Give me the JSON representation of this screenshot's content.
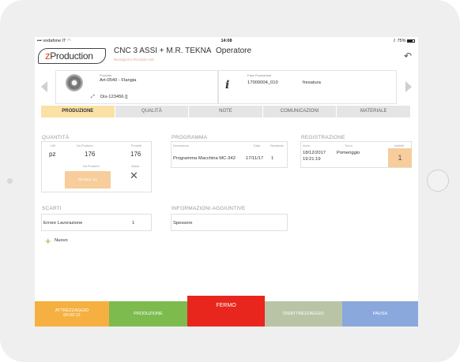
{
  "status_bar": {
    "carrier": "vodafone IT",
    "time": "14:08",
    "battery": "75%"
  },
  "header": {
    "brand_prefix": "z",
    "brand_rest": "Production",
    "title": "CNC 3 ASSI + M.R. TEKNA",
    "role": "Operatore",
    "subtitle": "Buongiorno Riccardo Aldi"
  },
  "product": {
    "label": "Prodotto",
    "name": "Art-0540 - Flangia",
    "drawing": "Dis-123456 []"
  },
  "phase": {
    "label": "Fase Produzione",
    "code": "17000004_010",
    "name": "fresatura"
  },
  "tabs": [
    "PRODUZIONE",
    "QUALITÀ",
    "NOTE",
    "COMUNICAZIONI",
    "MATERIALE"
  ],
  "quantity": {
    "title": "QUANTITÀ",
    "um_label": "UM",
    "um": "pz",
    "toproduce_label": "Da Produrre",
    "toproduce": "176",
    "produced_label": "Prodotti",
    "produced": "176",
    "declare_label": "Da Produrre",
    "declare_button": "Dichiara 1/1",
    "close_label": "Salda"
  },
  "program": {
    "title": "PROGRAMMA",
    "desc_label": "Descrizione",
    "date_label": "Data",
    "rev_label": "Revisione",
    "desc": "Programma Macchina MC-342",
    "date": "17/11/17",
    "rev": "1"
  },
  "registration": {
    "title": "REGISTRAZIONE",
    "start_label": "Inizio",
    "shift_label": "Turno",
    "workers_label": "Addetti",
    "start_date": "18/12/2017",
    "start_time": "19:21:19",
    "shift": "Pomeriggio",
    "workers": "1"
  },
  "scrap": {
    "title": "SCARTI",
    "item": "Errore Lavorazione",
    "qty": "1",
    "new_label": "Nuovo"
  },
  "additional": {
    "title": "INFORMAZIONI AGGIUNTIVE",
    "item": "Spessore"
  },
  "actions": {
    "setup_label": "ATTREZZAGGIO",
    "setup_time": "00:00:12",
    "production": "PRODUZIONE",
    "stop": "FERMO",
    "teardown": "DISATTREZZAGGIO",
    "pause": "PAUSA"
  },
  "colors": {
    "setup": "#f5b041",
    "production": "#7dbb4f",
    "stop": "#e8261d",
    "teardown": "#b9c4a7",
    "pause": "#8aa8dc",
    "active_tab": "#fbe1a6",
    "brand": "#d2481b"
  }
}
